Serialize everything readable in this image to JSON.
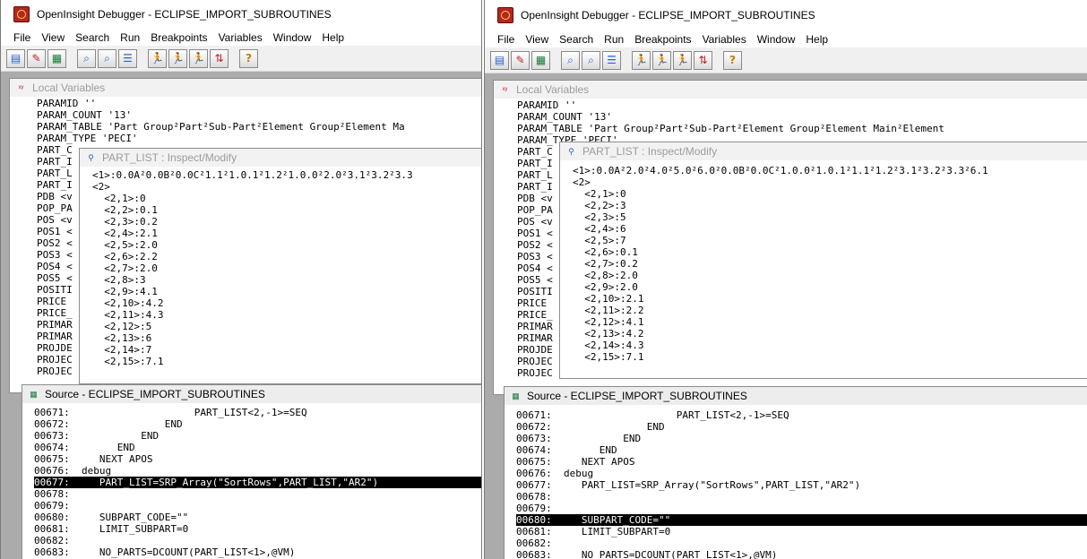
{
  "left": {
    "window_title": "OpenInsight Debugger - ECLIPSE_IMPORT_SUBROUTINES",
    "menu": [
      "File",
      "View",
      "Search",
      "Run",
      "Breakpoints",
      "Variables",
      "Window",
      "Help"
    ],
    "local_vars": {
      "title": "Local Variables",
      "lines": [
        "PARAMID ''",
        "PARAM_COUNT '13'",
        "PARAM_TABLE 'Part Group²Part²Sub-Part²Element Group²Element Ma",
        "PARAM_TYPE 'PECI'",
        "PART_C",
        "PART_I",
        "PART_L",
        "PART_I",
        "PDB <v",
        "POP_PA",
        "POS <v",
        "POS1 <",
        "POS2 <",
        "POS3 <",
        "POS4 <",
        "POS5 <",
        "POSITI",
        "PRICE",
        "PRICE_",
        "PRIMAR",
        "PRIMAR",
        "PROJDE",
        "PROJEC",
        "PROJEC"
      ]
    },
    "inspect": {
      "title": "PART_LIST : Inspect/Modify",
      "lines": [
        "<1>:0.0A²0.0B²0.0C²1.1²1.0.1²1.2²1.0.0²2.0²3.1²3.2²3.3",
        "<2>",
        "  <2,1>:0",
        "  <2,2>:0.1",
        "  <2,3>:0.2",
        "  <2,4>:2.1",
        "  <2,5>:2.0",
        "  <2,6>:2.2",
        "  <2,7>:2.0",
        "  <2,8>:3",
        "  <2,9>:4.1",
        "  <2,10>:4.2",
        "  <2,11>:4.3",
        "  <2,12>:5",
        "  <2,13>:6",
        "  <2,14>:7",
        "  <2,15>:7.1"
      ]
    },
    "source": {
      "title": "Source - ECLIPSE_IMPORT_SUBROUTINES",
      "lines": [
        "00671:                     PART_LIST<2,-1>=SEQ",
        "00672:                END",
        "00673:            END",
        "00674:        END",
        "00675:     NEXT APOS",
        "00676:  debug",
        "00677:     PART_LIST=SRP_Array(\"SortRows\",PART_LIST,\"AR2\")",
        "00678:",
        "00679:",
        "00680:     SUBPART_CODE=\"\"",
        "00681:     LIMIT_SUBPART=0",
        "00682:",
        "00683:     NO_PARTS=DCOUNT(PART_LIST<1>,@VM)"
      ],
      "highlight_line": "00677"
    }
  },
  "right": {
    "window_title": "OpenInsight Debugger - ECLIPSE_IMPORT_SUBROUTINES",
    "menu": [
      "File",
      "View",
      "Search",
      "Run",
      "Breakpoints",
      "Variables",
      "Window",
      "Help"
    ],
    "local_vars": {
      "title": "Local Variables",
      "lines": [
        "PARAMID ''",
        "PARAM_COUNT '13'",
        "PARAM_TABLE 'Part Group²Part²Sub-Part²Element Group²Element Main²Element",
        "PARAM_TYPE 'PECI'",
        "PART_C",
        "PART_I",
        "PART_L",
        "PART_I",
        "PDB <v",
        "POP_PA",
        "POS <v",
        "POS1 <",
        "POS2 <",
        "POS3 <",
        "POS4 <",
        "POS5 <",
        "POSITI",
        "PRICE",
        "PRICE_",
        "PRIMAR",
        "PRIMAR",
        "PROJDE",
        "PROJEC",
        "PROJEC"
      ]
    },
    "inspect": {
      "title": "PART_LIST : Inspect/Modify",
      "lines": [
        "<1>:0.0A²2.0²4.0²5.0²6.0²0.0B²0.0C²1.0.0²1.0.1²1.1²1.2²3.1²3.2²3.3²6.1",
        "<2>",
        "  <2,1>:0",
        "  <2,2>:3",
        "  <2,3>:5",
        "  <2,4>:6",
        "  <2,5>:7",
        "  <2,6>:0.1",
        "  <2,7>:0.2",
        "  <2,8>:2.0",
        "  <2,9>:2.0",
        "  <2,10>:2.1",
        "  <2,11>:2.2",
        "  <2,12>:4.1",
        "  <2,13>:4.2",
        "  <2,14>:4.3",
        "  <2,15>:7.1"
      ]
    },
    "source": {
      "title": "Source - ECLIPSE_IMPORT_SUBROUTINES",
      "lines": [
        "00671:                     PART_LIST<2,-1>=SEQ",
        "00672:                END",
        "00673:            END",
        "00674:        END",
        "00675:     NEXT APOS",
        "00676:  debug",
        "00677:     PART_LIST=SRP_Array(\"SortRows\",PART_LIST,\"AR2\")",
        "00678:",
        "00679:",
        "00680:     SUBPART_CODE=\"\"",
        "00681:     LIMIT_SUBPART=0",
        "00682:",
        "00683:     NO_PARTS=DCOUNT(PART_LIST<1>,@VM)"
      ],
      "highlight_line": "00680"
    }
  }
}
